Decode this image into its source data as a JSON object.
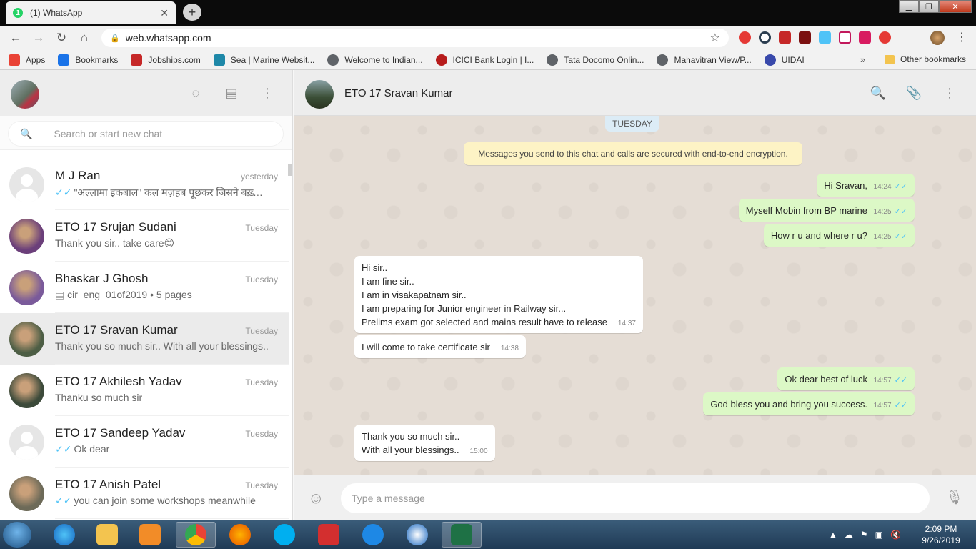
{
  "browser": {
    "tab_title": "(1) WhatsApp",
    "tab_badge": "1",
    "url": "web.whatsapp.com",
    "bookmarks": [
      {
        "label": "Apps",
        "color": "#e94235"
      },
      {
        "label": "Bookmarks",
        "color": "#1a73e8"
      },
      {
        "label": "Jobships.com",
        "color": "#c62828"
      },
      {
        "label": "Sea | Marine Websit...",
        "color": "#1e88a8"
      },
      {
        "label": "Welcome to Indian...",
        "color": "#5f6368"
      },
      {
        "label": "ICICI Bank Login | I...",
        "color": "#b71c1c"
      },
      {
        "label": "Tata Docomo Onlin...",
        "color": "#5f6368"
      },
      {
        "label": "Mahavitran View/P...",
        "color": "#5f6368"
      },
      {
        "label": "UIDAI",
        "color": "#3949ab"
      }
    ],
    "bookmarks_more": "»",
    "other_bookmarks": "Other bookmarks"
  },
  "sidebar": {
    "search_placeholder": "Search or start new chat",
    "chats": [
      {
        "name": "M J Ran",
        "time": "yesterday",
        "message": "\"अल्लामा इकबाल\" कल मज़हब पूछकर जिसने बख़्शी...",
        "ticks": "✓✓",
        "avatar": "default"
      },
      {
        "name": "ETO 17 Srujan Sudani",
        "time": "Tuesday",
        "message": "Thank you sir.. take care😊",
        "ticks": "",
        "avatar": "#6b3f7a"
      },
      {
        "name": "Bhaskar J Ghosh",
        "time": "Tuesday",
        "message": "cir_eng_01of2019 • 5 pages",
        "ticks": "",
        "avatar": "#7a5a9a"
      },
      {
        "name": "ETO 17 Sravan Kumar",
        "time": "Tuesday",
        "message": "Thank you so much sir.. With all your blessings..",
        "ticks": "",
        "avatar": "#4d5e45",
        "active": true
      },
      {
        "name": "ETO 17 Akhilesh Yadav",
        "time": "Tuesday",
        "message": "Thanku so much sir",
        "ticks": "",
        "avatar": "#3c4a3a"
      },
      {
        "name": "ETO 17 Sandeep Yadav",
        "time": "Tuesday",
        "message": "Ok dear",
        "ticks": "✓✓",
        "avatar": "default"
      },
      {
        "name": "ETO 17 Anish Patel",
        "time": "Tuesday",
        "message": "you can join some workshops meanwhile",
        "ticks": "✓✓",
        "avatar": "#6d6a58"
      }
    ]
  },
  "conversation": {
    "contact_name": "ETO 17 Sravan Kumar",
    "day_chip": "TUESDAY",
    "encryption_notice": "Messages you send to this chat and calls are secured with end-to-end encryption.",
    "messages": [
      {
        "dir": "out",
        "lines": [
          "Hi Sravan,"
        ],
        "time": "14:24"
      },
      {
        "dir": "out",
        "lines": [
          "Myself Mobin from BP marine"
        ],
        "time": "14:25"
      },
      {
        "dir": "out",
        "lines": [
          "How r u and where r u?"
        ],
        "time": "14:25"
      },
      {
        "dir": "in",
        "lines": [
          "Hi sir..",
          "I am fine sir..",
          "I am in visakapatnam sir..",
          "I am preparing for Junior engineer in Railway sir...",
          "Prelims exam got selected and mains result have to release"
        ],
        "time": "14:37"
      },
      {
        "dir": "in",
        "lines": [
          "I will come to take certificate sir"
        ],
        "time": "14:38"
      },
      {
        "dir": "out",
        "lines": [
          "Ok dear best of luck"
        ],
        "time": "14:57"
      },
      {
        "dir": "out",
        "lines": [
          "God bless you and bring you success."
        ],
        "time": "14:57"
      },
      {
        "dir": "in",
        "lines": [
          "Thank you so much sir..",
          "With all your blessings.."
        ],
        "time": "15:00"
      }
    ],
    "compose_placeholder": "Type a message"
  },
  "taskbar": {
    "clock_time": "2:09 PM",
    "clock_date": "9/26/2019"
  },
  "colors": {
    "outgoing_bubble": "#dcf8c6",
    "incoming_bubble": "#ffffff",
    "read_tick": "#4fc3f7",
    "chat_background": "#e5ddd5"
  }
}
